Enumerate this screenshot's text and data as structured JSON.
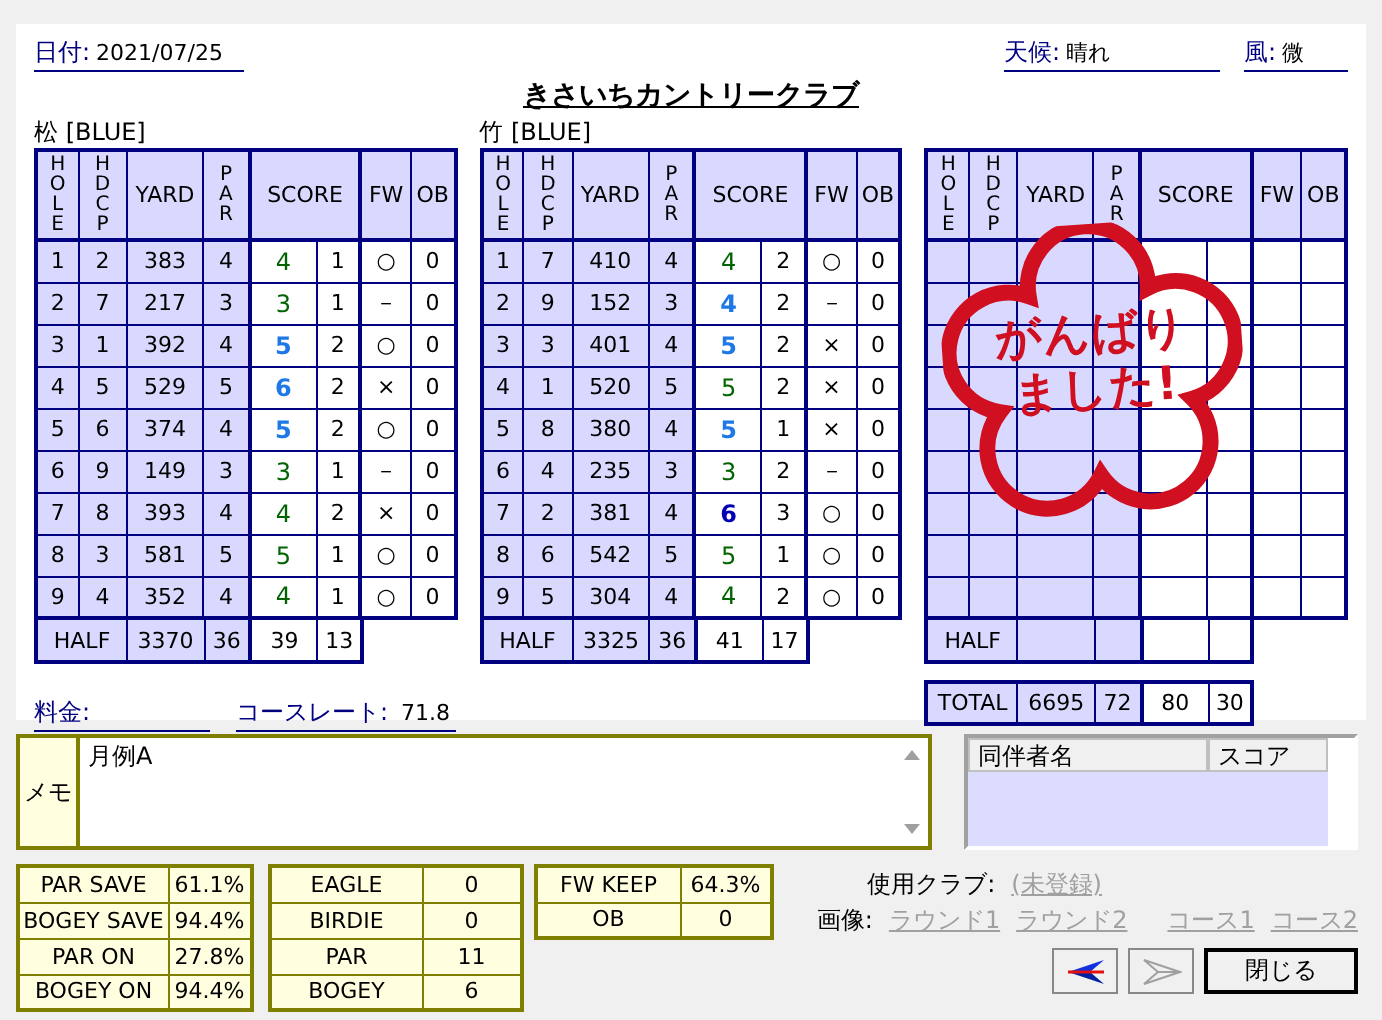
{
  "date": {
    "label": "日付:",
    "value": "2021/07/25"
  },
  "weather": {
    "label": "天候:",
    "value": "晴れ"
  },
  "wind": {
    "label": "風:",
    "value": "微"
  },
  "course_name": "きさいちカントリークラブ",
  "rounds": [
    {
      "title": "松 [BLUE]",
      "columns": [
        "HOLE",
        "HDCP",
        "YARD",
        "PAR",
        "SCORE",
        "FW",
        "OB"
      ],
      "holes": [
        {
          "hole": "1",
          "hdcp": "2",
          "yard": "383",
          "par": "4",
          "score": "4",
          "color": "#006400",
          "putts": "1",
          "fw": "○",
          "ob": "0"
        },
        {
          "hole": "2",
          "hdcp": "7",
          "yard": "217",
          "par": "3",
          "score": "3",
          "color": "#006400",
          "putts": "1",
          "fw": "－",
          "ob": "0"
        },
        {
          "hole": "3",
          "hdcp": "1",
          "yard": "392",
          "par": "4",
          "score": "5",
          "color": "#1e78e6",
          "putts": "2",
          "fw": "○",
          "ob": "0"
        },
        {
          "hole": "4",
          "hdcp": "5",
          "yard": "529",
          "par": "5",
          "score": "6",
          "color": "#1e78e6",
          "putts": "2",
          "fw": "×",
          "ob": "0"
        },
        {
          "hole": "5",
          "hdcp": "6",
          "yard": "374",
          "par": "4",
          "score": "5",
          "color": "#1e78e6",
          "putts": "2",
          "fw": "○",
          "ob": "0"
        },
        {
          "hole": "6",
          "hdcp": "9",
          "yard": "149",
          "par": "3",
          "score": "3",
          "color": "#006400",
          "putts": "1",
          "fw": "－",
          "ob": "0"
        },
        {
          "hole": "7",
          "hdcp": "8",
          "yard": "393",
          "par": "4",
          "score": "4",
          "color": "#006400",
          "putts": "2",
          "fw": "×",
          "ob": "0"
        },
        {
          "hole": "8",
          "hdcp": "3",
          "yard": "581",
          "par": "5",
          "score": "5",
          "color": "#006400",
          "putts": "1",
          "fw": "○",
          "ob": "0"
        },
        {
          "hole": "9",
          "hdcp": "4",
          "yard": "352",
          "par": "4",
          "score": "4",
          "color": "#006400",
          "putts": "1",
          "fw": "○",
          "ob": "0"
        }
      ],
      "half": {
        "label": "HALF",
        "yard": "3370",
        "par": "36",
        "score": "39",
        "putts": "13"
      }
    },
    {
      "title": "竹 [BLUE]",
      "columns": [
        "HOLE",
        "HDCP",
        "YARD",
        "PAR",
        "SCORE",
        "FW",
        "OB"
      ],
      "holes": [
        {
          "hole": "1",
          "hdcp": "7",
          "yard": "410",
          "par": "4",
          "score": "4",
          "color": "#006400",
          "putts": "2",
          "fw": "○",
          "ob": "0"
        },
        {
          "hole": "2",
          "hdcp": "9",
          "yard": "152",
          "par": "3",
          "score": "4",
          "color": "#1e78e6",
          "putts": "2",
          "fw": "－",
          "ob": "0"
        },
        {
          "hole": "3",
          "hdcp": "3",
          "yard": "401",
          "par": "4",
          "score": "5",
          "color": "#1e78e6",
          "putts": "2",
          "fw": "×",
          "ob": "0"
        },
        {
          "hole": "4",
          "hdcp": "1",
          "yard": "520",
          "par": "5",
          "score": "5",
          "color": "#006400",
          "putts": "2",
          "fw": "×",
          "ob": "0"
        },
        {
          "hole": "5",
          "hdcp": "8",
          "yard": "380",
          "par": "4",
          "score": "5",
          "color": "#1e78e6",
          "putts": "1",
          "fw": "×",
          "ob": "0"
        },
        {
          "hole": "6",
          "hdcp": "4",
          "yard": "235",
          "par": "3",
          "score": "3",
          "color": "#006400",
          "putts": "2",
          "fw": "－",
          "ob": "0"
        },
        {
          "hole": "7",
          "hdcp": "2",
          "yard": "381",
          "par": "4",
          "score": "6",
          "color": "#0000b4",
          "putts": "3",
          "fw": "○",
          "ob": "0"
        },
        {
          "hole": "8",
          "hdcp": "6",
          "yard": "542",
          "par": "5",
          "score": "5",
          "color": "#006400",
          "putts": "1",
          "fw": "○",
          "ob": "0"
        },
        {
          "hole": "9",
          "hdcp": "5",
          "yard": "304",
          "par": "4",
          "score": "4",
          "color": "#006400",
          "putts": "2",
          "fw": "○",
          "ob": "0"
        }
      ],
      "half": {
        "label": "HALF",
        "yard": "3325",
        "par": "36",
        "score": "41",
        "putts": "17"
      }
    },
    {
      "columns": [
        "HOLE",
        "HDCP",
        "YARD",
        "PAR",
        "SCORE",
        "FW",
        "OB"
      ],
      "half": {
        "label": "HALF"
      }
    }
  ],
  "total": {
    "label": "TOTAL",
    "yard": "6695",
    "par": "72",
    "score": "80",
    "putts": "30"
  },
  "stamp": [
    "がんばり",
    "ました!"
  ],
  "fee": {
    "label": "料金:"
  },
  "course_rate": {
    "label": "コースレート:",
    "value": "71.8"
  },
  "memo": {
    "label": "メモ",
    "value": "月例A"
  },
  "companions": {
    "columns": [
      "同伴者名",
      "スコア"
    ]
  },
  "stats": [
    [
      {
        "label": "PAR SAVE",
        "value": "61.1%"
      },
      {
        "label": "BOGEY SAVE",
        "value": "94.4%"
      },
      {
        "label": "PAR ON",
        "value": "27.8%"
      },
      {
        "label": "BOGEY ON",
        "value": "94.4%"
      }
    ],
    [
      {
        "label": "EAGLE",
        "value": "0"
      },
      {
        "label": "BIRDIE",
        "value": "0"
      },
      {
        "label": "PAR",
        "value": "11"
      },
      {
        "label": "BOGEY",
        "value": "6"
      }
    ],
    [
      {
        "label": "FW KEEP",
        "value": "64.3%"
      },
      {
        "label": "OB",
        "value": "0"
      }
    ]
  ],
  "club": {
    "label": "使用クラブ:",
    "link": "(未登録)",
    "disabled": true
  },
  "images": {
    "label": "画像:",
    "links": [
      {
        "text": "ラウンド1",
        "disabled": true
      },
      {
        "text": "ラウンド2",
        "disabled": true
      },
      {
        "text": "コース1",
        "disabled": true
      },
      {
        "text": "コース2",
        "disabled": true
      }
    ]
  },
  "back": {
    "disabled": false
  },
  "forward": {
    "disabled": true
  },
  "close_button": "閉じる"
}
